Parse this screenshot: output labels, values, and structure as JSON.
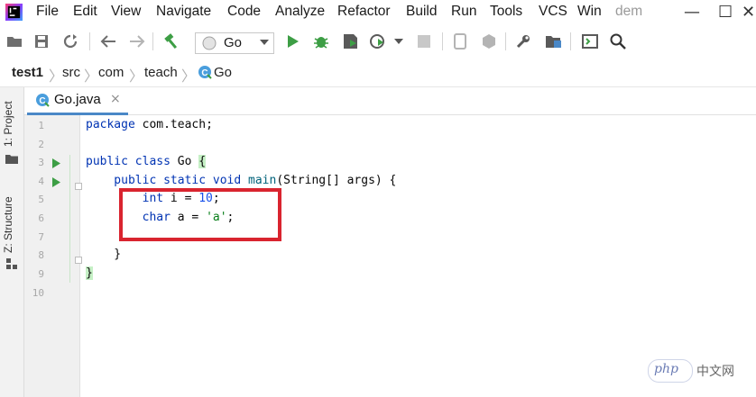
{
  "menu": [
    "File",
    "Edit",
    "View",
    "Navigate",
    "Code",
    "Analyze",
    "Refactor",
    "Build",
    "Run",
    "Tools",
    "VCS",
    "Win",
    "dem"
  ],
  "window_controls": [
    "—",
    "☐",
    "✕"
  ],
  "toolbar": {
    "run_config": "Go",
    "icons": [
      "open-folder-icon",
      "save-icon",
      "sync-icon",
      "back-arrow-icon",
      "forward-arrow-icon",
      "build-hammer-icon",
      "run-icon",
      "debug-bug-icon",
      "coverage-icon",
      "profile-icon",
      "stop-icon",
      "avd-icon",
      "sdk-icon",
      "settings-wrench-icon",
      "project-structure-icon",
      "terminal-icon",
      "search-icon"
    ]
  },
  "breadcrumb": [
    "test1",
    "src",
    "com",
    "teach",
    "Go"
  ],
  "left_strip": {
    "project": "1: Project",
    "structure": "Z: Structure"
  },
  "tab": {
    "label": "Go.java",
    "close": "×",
    "class_badge": "C"
  },
  "code": {
    "line_numbers": [
      "1",
      "2",
      "3",
      "4",
      "5",
      "6",
      "7",
      "8",
      "9",
      "10"
    ],
    "lines": [
      [
        {
          "t": "package ",
          "c": "kw"
        },
        {
          "t": "com.teach;",
          "c": ""
        }
      ],
      [],
      [
        {
          "t": "public class ",
          "c": "kw"
        },
        {
          "t": "Go ",
          "c": ""
        },
        {
          "t": "{",
          "c": "brace-hl"
        }
      ],
      [
        {
          "t": "    public static void ",
          "c": "kw"
        },
        {
          "t": "main",
          "c": "fn"
        },
        {
          "t": "(String[] args) {",
          "c": ""
        }
      ],
      [
        {
          "t": "        int ",
          "c": "kw"
        },
        {
          "t": "i = ",
          "c": ""
        },
        {
          "t": "10",
          "c": "num"
        },
        {
          "t": ";",
          "c": ""
        }
      ],
      [
        {
          "t": "        char ",
          "c": "kw"
        },
        {
          "t": "a = ",
          "c": ""
        },
        {
          "t": "'a'",
          "c": "str"
        },
        {
          "t": ";",
          "c": ""
        }
      ],
      [],
      [
        {
          "t": "    }",
          "c": ""
        }
      ],
      [
        {
          "t": "}",
          "c": "brace-hl"
        }
      ],
      []
    ]
  },
  "watermark": {
    "logo": "php",
    "text": "中文网"
  },
  "colors": {
    "accent": "#4a88c7",
    "annotation": "#d9242f",
    "run_green": "#3d9e45"
  }
}
